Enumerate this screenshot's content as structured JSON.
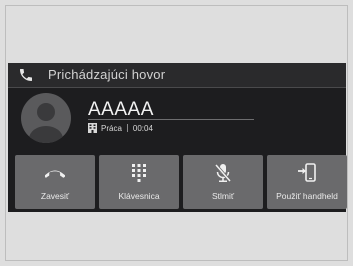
{
  "header": {
    "title": "Prichádzajúci hovor",
    "icon": "phone-icon"
  },
  "caller": {
    "name": "AAAAA",
    "type_icon": "building-icon",
    "type_label": "Práca",
    "duration": "00:04",
    "avatar_icon": "person-avatar-icon"
  },
  "buttons": [
    {
      "label": "Zavesiť",
      "icon": "hang-up-icon"
    },
    {
      "label": "Klávesnica",
      "icon": "keypad-icon"
    },
    {
      "label": "Stlmiť",
      "icon": "mute-icon"
    },
    {
      "label": "Použiť handheld",
      "icon": "handheld-icon"
    }
  ],
  "colors": {
    "screen_bg": "#1d1d1f",
    "button_bg": "#6a6a6c",
    "page_bg": "#dedede"
  }
}
